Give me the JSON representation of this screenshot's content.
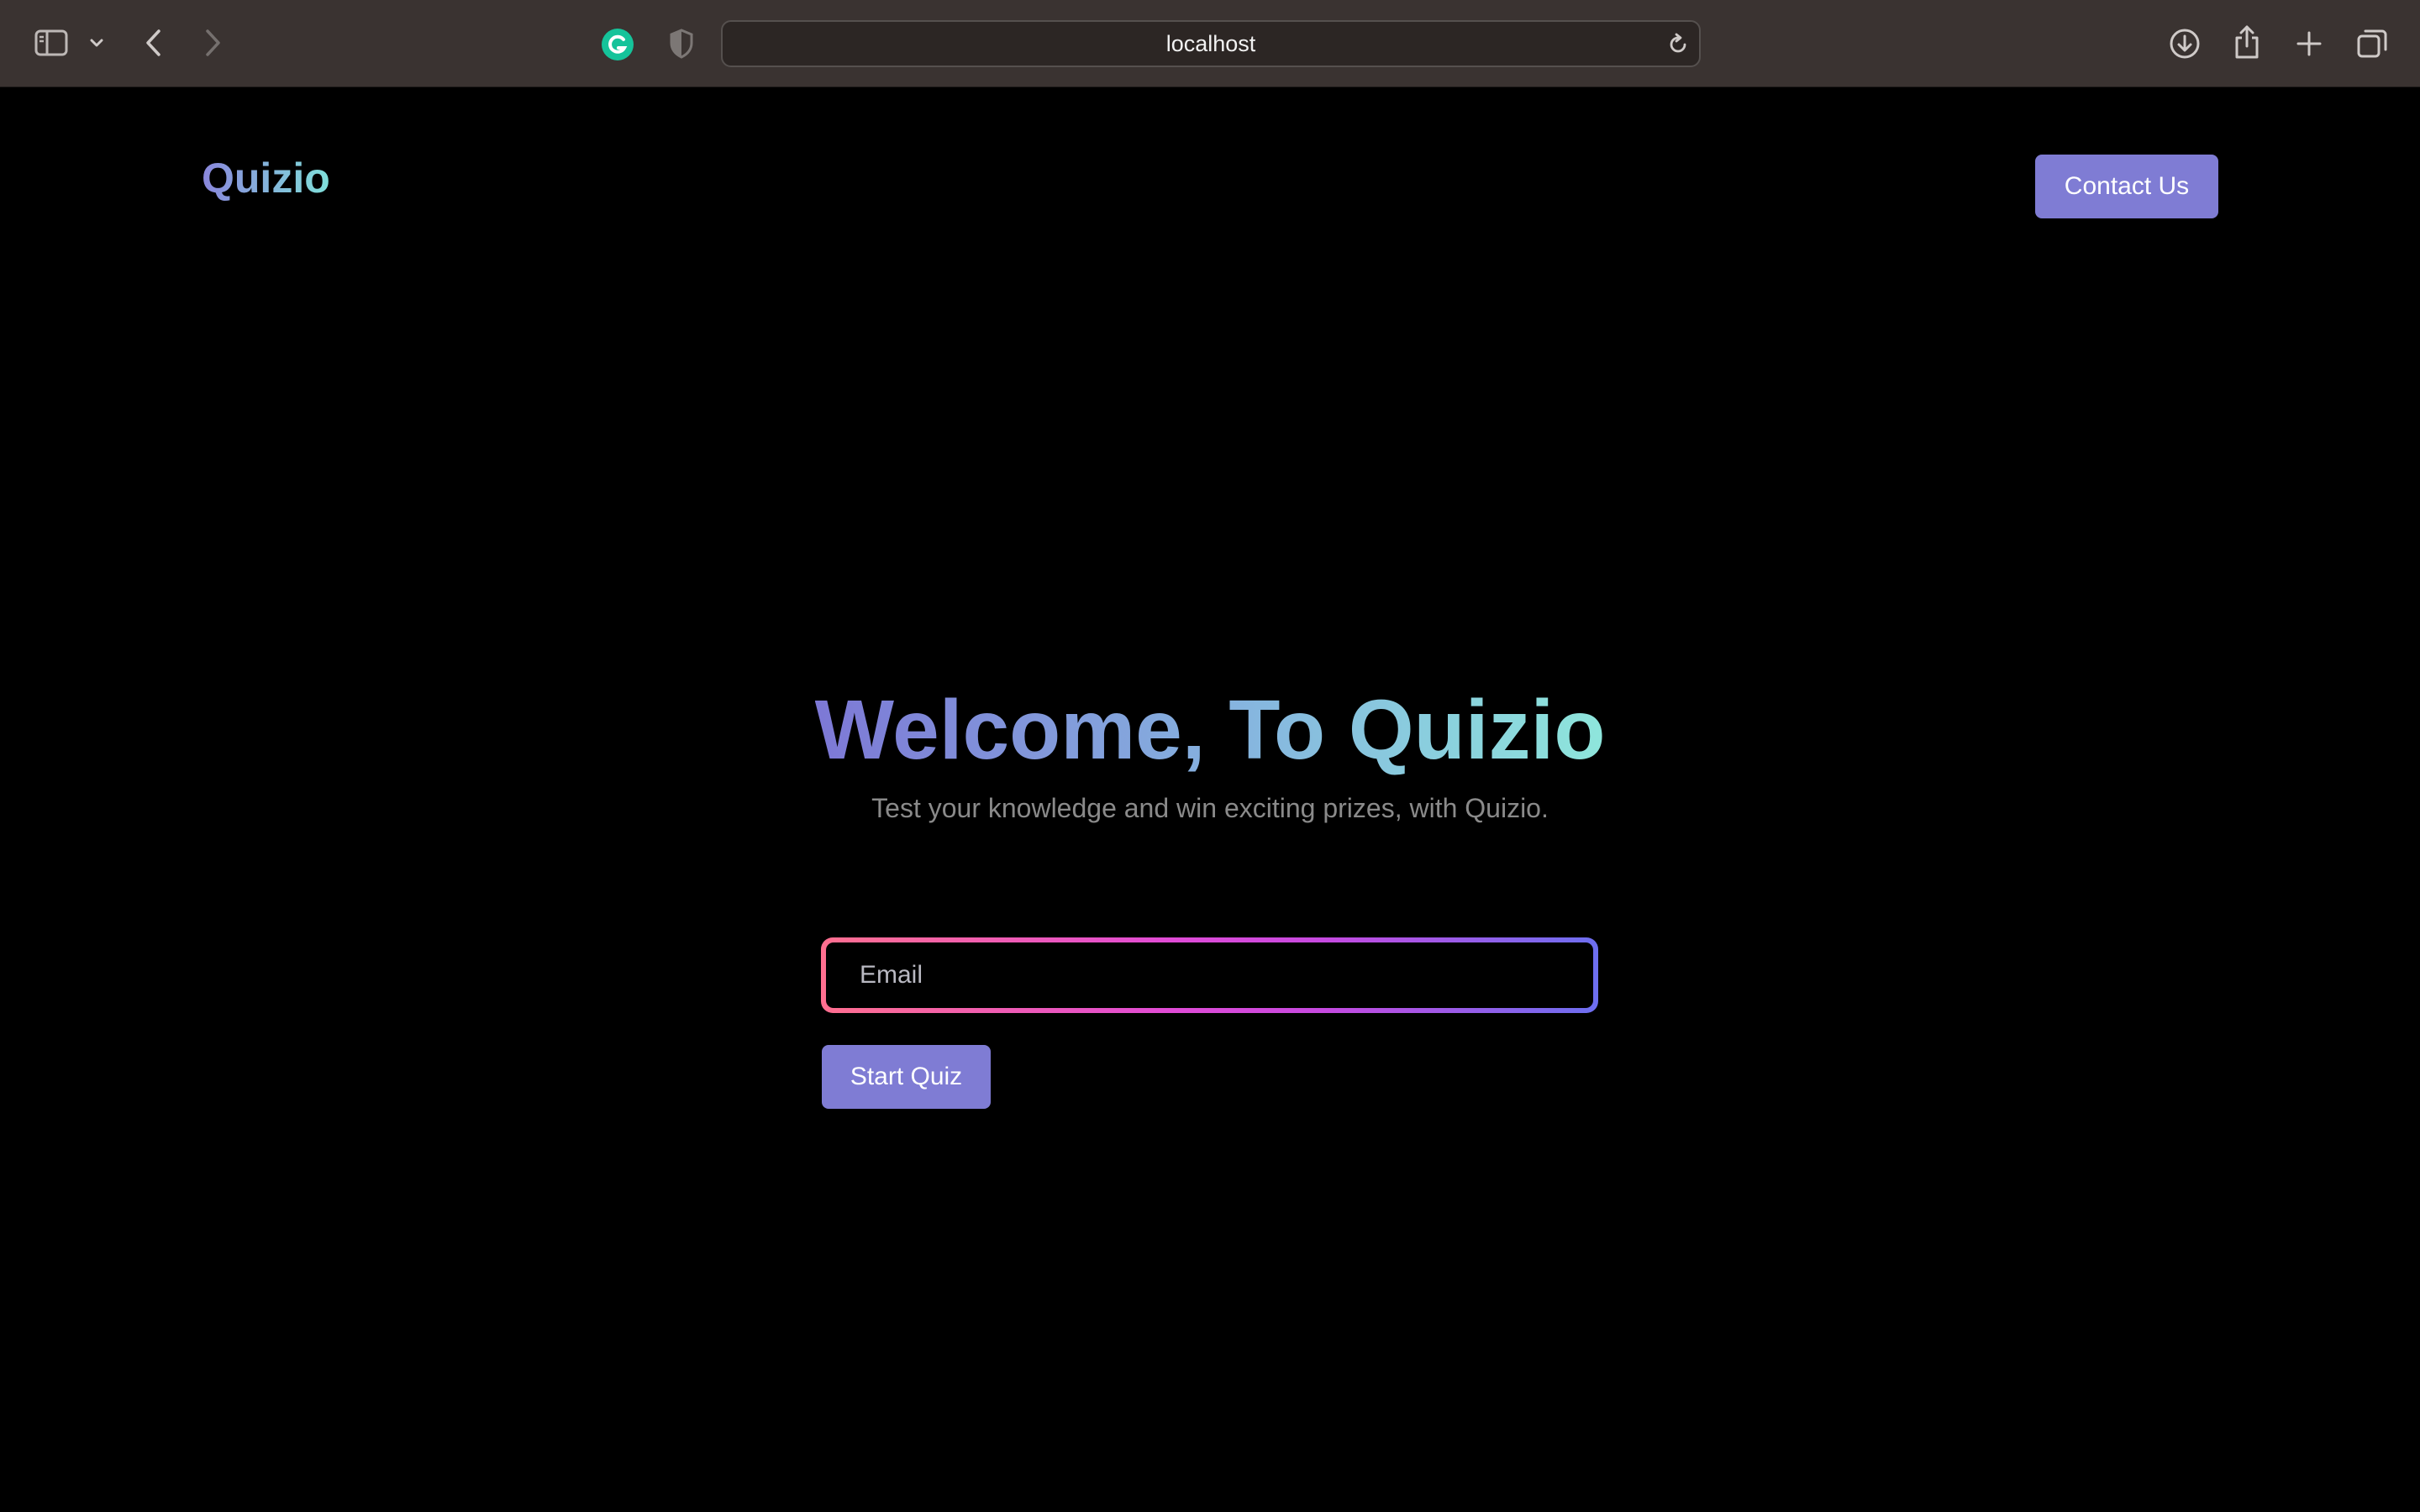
{
  "browser": {
    "address": "localhost",
    "icons": {
      "sidebar": "sidebar-icon",
      "chevron": "chevron-down-icon",
      "back": "back-arrow-icon",
      "forward": "forward-arrow-icon",
      "extension": "grammarly-icon",
      "privacy": "shield-icon",
      "reload": "reload-icon",
      "download": "download-icon",
      "share": "share-icon",
      "new_tab": "plus-icon",
      "tab_overview": "tabs-icon"
    }
  },
  "header": {
    "logo": "Quizio",
    "contact_label": "Contact Us"
  },
  "hero": {
    "title": "Welcome, To Quizio",
    "subtitle": "Test your knowledge and win exciting prizes, with Quizio."
  },
  "form": {
    "email_placeholder": "Email",
    "email_value": "",
    "start_label": "Start Quiz"
  },
  "colors": {
    "accent": "#7f7cd4",
    "gradient_start": "#7d78d6",
    "gradient_end": "#8ee6dc",
    "input_border_start": "#ff6f8f",
    "input_border_end": "#6d6ff0",
    "background": "#000000",
    "chrome": "#3a3331"
  }
}
